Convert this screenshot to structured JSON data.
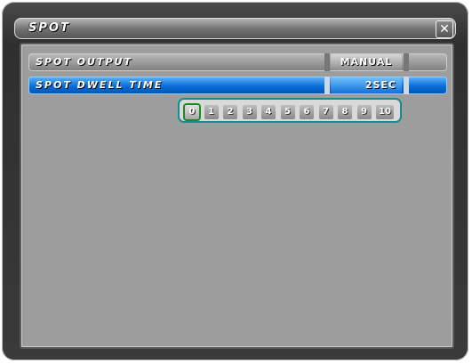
{
  "window": {
    "title": "SPOT",
    "close_label": "✕"
  },
  "settings": [
    {
      "label": "SPOT OUTPUT",
      "value": "MANUAL"
    },
    {
      "label": "SPOT DWELL TIME",
      "value": "2SEC"
    }
  ],
  "dwell_picker": {
    "options": [
      "0",
      "1",
      "2",
      "3",
      "4",
      "5",
      "6",
      "7",
      "8",
      "9",
      "10"
    ],
    "selected": "0"
  },
  "colors": {
    "highlight_row": "#0a6cd8",
    "picker_border": "#1b8a8a",
    "selected_outline": "#1c8c1c"
  }
}
